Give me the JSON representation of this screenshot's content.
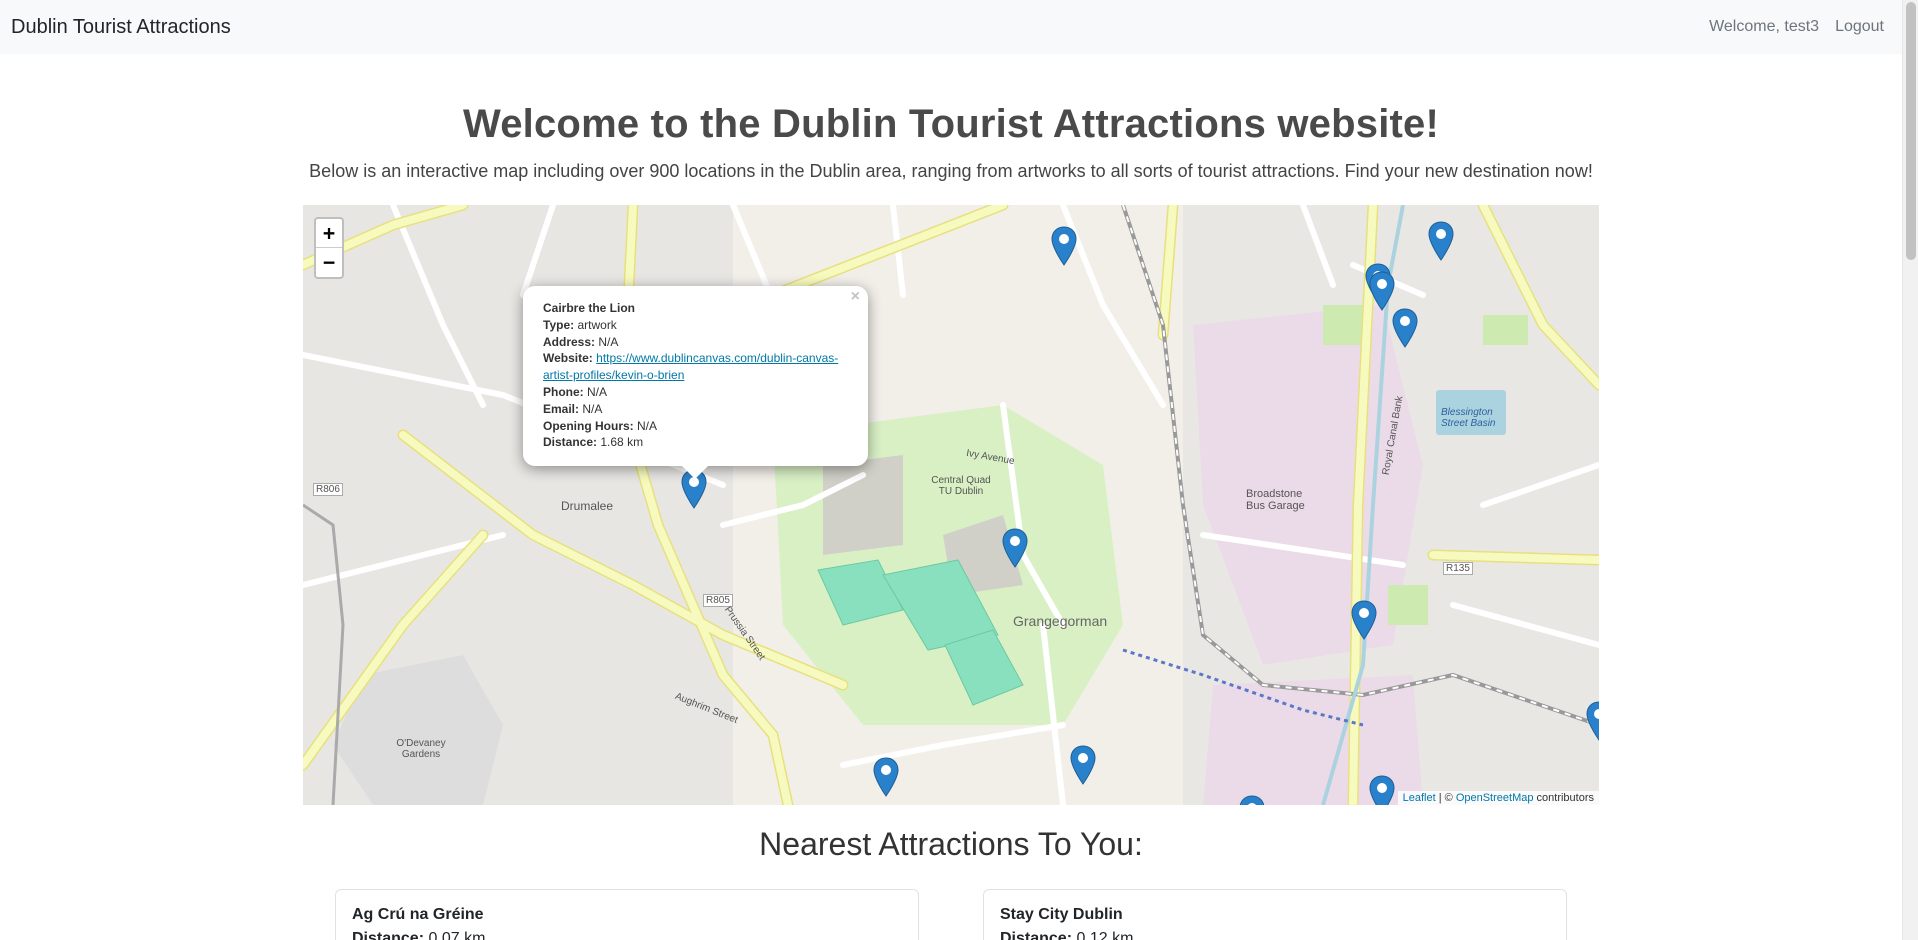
{
  "nav": {
    "brand": "Dublin Tourist Attractions",
    "welcome": "Welcome, test3",
    "logout": "Logout"
  },
  "hero": {
    "title": "Welcome to the Dublin Tourist Attractions website!",
    "subtitle": "Below is an interactive map including over 900 locations in the Dublin area, ranging from artworks to all sorts of tourist attractions. Find your new destination now!"
  },
  "map": {
    "zoom_in": "+",
    "zoom_out": "−",
    "attribution_leaflet": "Leaflet",
    "attribution_sep": " | © ",
    "attribution_osm": "OpenStreetMap",
    "attribution_suffix": " contributors",
    "labels": {
      "grangegorman": "Grangegorman",
      "drumalee": "Drumalee",
      "broadstone_garage": "Broadstone Bus Garage",
      "central_quad": "Central Quad TU Dublin",
      "blessington_basin": "Blessington Street Basin",
      "r805": "R805",
      "r806": "R806",
      "r135": "R135",
      "odevaney": "O'Devaney Gardens",
      "aughrim_street": "Aughrim Street",
      "prussia_street": "Prussia Street",
      "ivy_avenue": "Ivy Avenue",
      "royal_canal_bank": "Royal Canal Bank"
    }
  },
  "popup": {
    "name": "Cairbre the Lion",
    "type_label": "Type:",
    "type": "artwork",
    "address_label": "Address:",
    "address": "N/A",
    "website_label": "Website:",
    "website": "https://www.dublincanvas.com/dublin-canvas-artist-profiles/kevin-o-brien",
    "phone_label": "Phone:",
    "phone": "N/A",
    "email_label": "Email:",
    "email": "N/A",
    "hours_label": "Opening Hours:",
    "hours": "N/A",
    "distance_label": "Distance:",
    "distance": "1.68 km",
    "close": "×"
  },
  "nearest": {
    "title": "Nearest Attractions To You:",
    "cards": [
      {
        "name": "Ag Crú na Gréine",
        "distance_label": "Distance:",
        "distance": "0.07 km"
      },
      {
        "name": "Stay City Dublin",
        "distance_label": "Distance:",
        "distance": "0.12 km"
      }
    ]
  },
  "colors": {
    "marker": "#2a81cb",
    "park": "#cdebb0",
    "pitch": "#88e0be",
    "primary_road": "#f7fabf",
    "link": "#0078a8"
  }
}
